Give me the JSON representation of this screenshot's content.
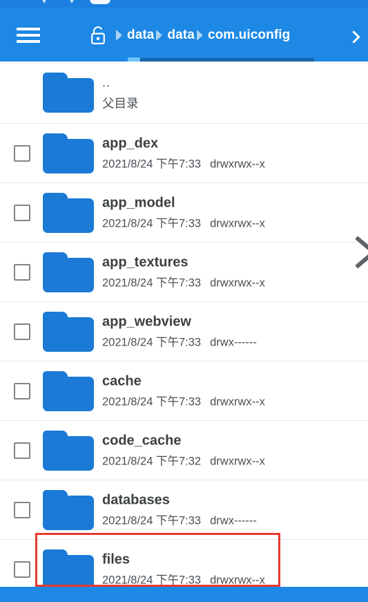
{
  "app": {
    "accent_color": "#1e88e5",
    "folder_color": "#1a7ad6",
    "annotation_color": "#e8392f",
    "text_color": "#3c4043"
  },
  "statusbar": {
    "icons": [
      "signal-icon",
      "signal-icon",
      "battery-icon"
    ]
  },
  "appbar": {
    "menu_icon": "hamburger-menu-icon",
    "lock_icon": "unlocked-padlock-icon",
    "forward_icon": "chevron-right-icon",
    "breadcrumbs": [
      {
        "label": "data"
      },
      {
        "label": "data"
      },
      {
        "label": "com.uiconfig"
      }
    ]
  },
  "drawer_pull": {
    "icon": "chevron-right-icon"
  },
  "list": {
    "parent_row": {
      "name": "..",
      "meta": "父目录",
      "icon": "folder-icon"
    },
    "rows": [
      {
        "name": "app_dex",
        "date": "2021/8/24 下午7:33",
        "perm": "drwxrwx--x",
        "icon": "folder-icon",
        "checked": false,
        "highlighted": false
      },
      {
        "name": "app_model",
        "date": "2021/8/24 下午7:33",
        "perm": "drwxrwx--x",
        "icon": "folder-icon",
        "checked": false,
        "highlighted": false
      },
      {
        "name": "app_textures",
        "date": "2021/8/24 下午7:33",
        "perm": "drwxrwx--x",
        "icon": "folder-icon",
        "checked": false,
        "highlighted": false
      },
      {
        "name": "app_webview",
        "date": "2021/8/24 下午7:33",
        "perm": "drwx------",
        "icon": "folder-icon",
        "checked": false,
        "highlighted": false
      },
      {
        "name": "cache",
        "date": "2021/8/24 下午7:33",
        "perm": "drwxrwx--x",
        "icon": "folder-icon",
        "checked": false,
        "highlighted": false
      },
      {
        "name": "code_cache",
        "date": "2021/8/24 下午7:32",
        "perm": "drwxrwx--x",
        "icon": "folder-icon",
        "checked": false,
        "highlighted": false
      },
      {
        "name": "databases",
        "date": "2021/8/24 下午7:33",
        "perm": "drwx------",
        "icon": "folder-icon",
        "checked": false,
        "highlighted": false
      },
      {
        "name": "files",
        "date": "2021/8/24 下午7:33",
        "perm": "drwxrwx--x",
        "icon": "folder-icon",
        "checked": false,
        "highlighted": true
      }
    ]
  }
}
